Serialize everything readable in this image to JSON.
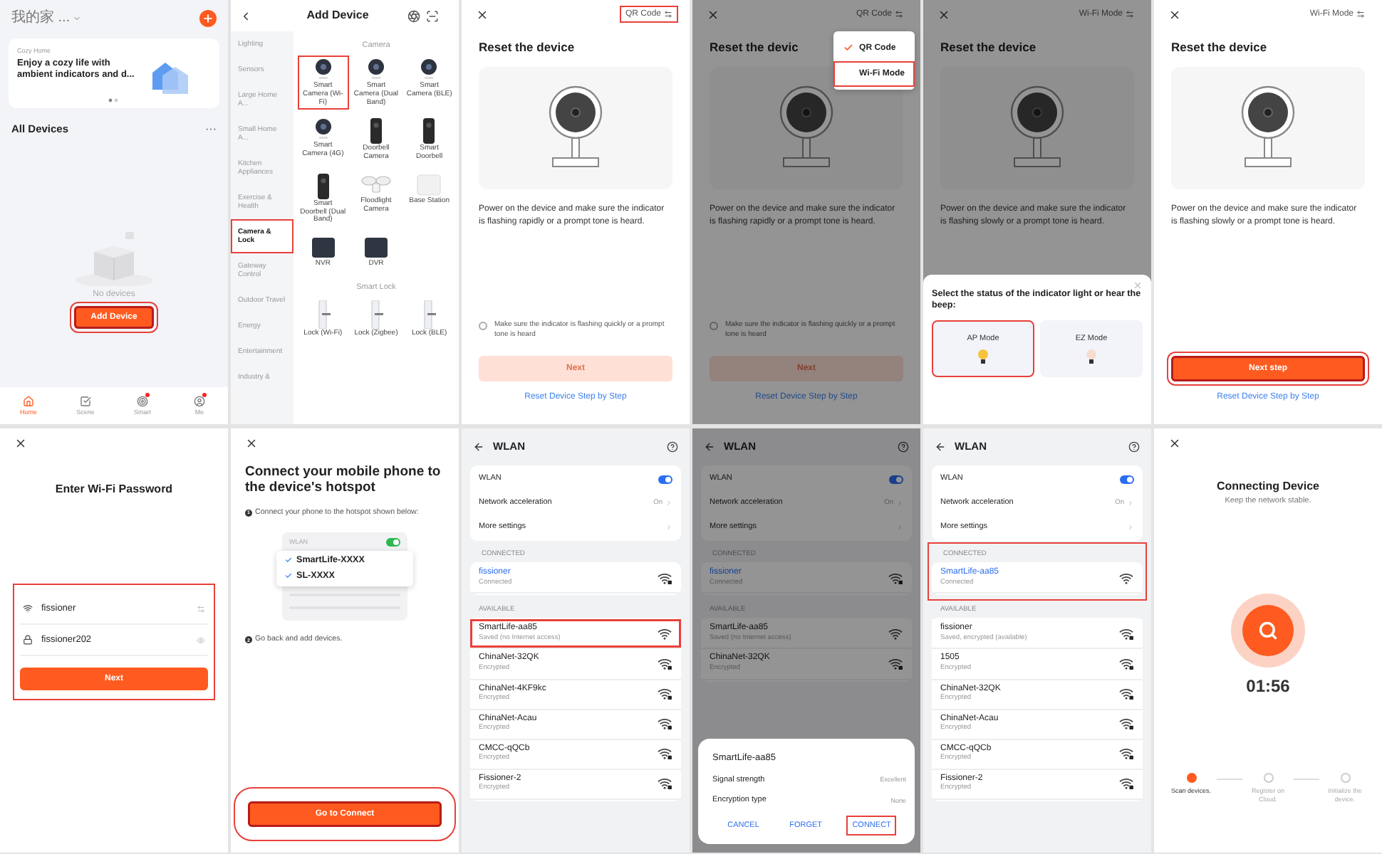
{
  "screens": [
    {
      "kind": "home",
      "home_name": "我的家 ...",
      "banner": {
        "label": "Cozy Home",
        "text": "Enjoy a cozy life with ambient indicators and d..."
      },
      "section_title": "All Devices",
      "more": "···",
      "empty_text": "No devices",
      "add_button": {
        "label": "Add Device",
        "highlighted": true
      },
      "tabs": [
        {
          "kind": "home",
          "label": "Home",
          "selected": true,
          "badge": false
        },
        {
          "kind": "scene",
          "label": "Scene",
          "selected": false,
          "badge": false
        },
        {
          "kind": "smart",
          "label": "Smart",
          "selected": false,
          "badge": true
        },
        {
          "kind": "me",
          "label": "Me",
          "selected": false,
          "badge": true
        }
      ]
    },
    {
      "kind": "catalog",
      "title": "Add Device",
      "categories": [
        {
          "label": "Lighting",
          "selected": false,
          "highlighted": false
        },
        {
          "label": "Sensors",
          "selected": false,
          "highlighted": false
        },
        {
          "label": "Large Home A...",
          "selected": false,
          "highlighted": false
        },
        {
          "label": "Small Home A...",
          "selected": false,
          "highlighted": false
        },
        {
          "label": "Kitchen Appliances",
          "selected": false,
          "highlighted": false
        },
        {
          "label": "Exercise & Health",
          "selected": false,
          "highlighted": false
        },
        {
          "label": "Camera & Lock",
          "selected": true,
          "highlighted": true
        },
        {
          "label": "Gateway Control",
          "selected": false,
          "highlighted": false
        },
        {
          "label": "Outdoor Travel",
          "selected": false,
          "highlighted": false
        },
        {
          "label": "Energy",
          "selected": false,
          "highlighted": false
        },
        {
          "label": "Entertainment",
          "selected": false,
          "highlighted": false
        },
        {
          "label": "Industry &",
          "selected": false,
          "highlighted": false
        }
      ],
      "sections": [
        {
          "title": "Camera",
          "items": [
            {
              "kind": "camera",
              "label": "Smart Camera (Wi-Fi)",
              "highlighted": true
            },
            {
              "kind": "camera",
              "label": "Smart Camera (Dual Band)",
              "highlighted": false
            },
            {
              "kind": "camera",
              "label": "Smart Camera (BLE)",
              "highlighted": false
            },
            {
              "kind": "camera",
              "label": "Smart Camera (4G)",
              "highlighted": false
            },
            {
              "kind": "doorbell",
              "label": "Doorbell Camera",
              "highlighted": false
            },
            {
              "kind": "doorbell",
              "label": "Smart Doorbell",
              "highlighted": false
            },
            {
              "kind": "doorbell",
              "label": "Smart Doorbell (Dual Band)",
              "highlighted": false
            },
            {
              "kind": "floodlight",
              "label": "Floodlight Camera",
              "highlighted": false
            },
            {
              "kind": "station",
              "label": "Base Station",
              "highlighted": false
            },
            {
              "kind": "recorder",
              "label": "NVR",
              "highlighted": false
            },
            {
              "kind": "recorder",
              "label": "DVR",
              "highlighted": false
            }
          ]
        },
        {
          "title": "Smart Lock",
          "items": [
            {
              "kind": "lock",
              "label": "Lock (Wi-Fi)",
              "highlighted": false
            },
            {
              "kind": "lock",
              "label": "Lock (Zigbee)",
              "highlighted": false
            },
            {
              "kind": "lock",
              "label": "Lock (BLE)",
              "highlighted": false
            }
          ]
        }
      ]
    },
    {
      "kind": "reset",
      "dimmed": false,
      "mode": {
        "label": "QR Code",
        "highlighted": true
      },
      "title": "Reset the device",
      "description": "Power on the device and make sure the indicator is flashing rapidly or a prompt tone is heard.",
      "confirm": {
        "label": "Make sure the indicator is flashing quickly or a prompt tone is heard",
        "checked": false
      },
      "next": {
        "label": "Next",
        "disabled": true,
        "highlighted": false
      },
      "link": "Reset Device Step by Step"
    },
    {
      "kind": "reset",
      "dimmed": true,
      "mode": {
        "label": "QR Code",
        "highlighted": false
      },
      "title": "Reset the devic",
      "description": "Power on the device and make sure the indicator is flashing rapidly or a prompt tone is heard.",
      "confirm": {
        "label": "Make sure the indicator is flashing quickly or a prompt tone is heard",
        "checked": false
      },
      "next": {
        "label": "Next",
        "disabled": true,
        "highlighted": false
      },
      "link": "Reset Device Step by Step",
      "menu": [
        {
          "label": "QR Code",
          "selected": true,
          "highlighted": false
        },
        {
          "label": "Wi-Fi Mode",
          "selected": false,
          "highlighted": true
        }
      ]
    },
    {
      "kind": "reset",
      "dimmed": true,
      "mode": {
        "label": "Wi-Fi Mode",
        "highlighted": false
      },
      "title": "Reset the device",
      "description": "Power on the device and make sure the indicator is flashing slowly or a prompt tone is heard.",
      "sheet": {
        "prompt": "Select the status of the indicator light or hear the beep:",
        "options": [
          {
            "label": "AP Mode",
            "kind": "bright",
            "highlighted": true
          },
          {
            "label": "EZ Mode",
            "kind": "faint",
            "highlighted": false
          }
        ]
      }
    },
    {
      "kind": "reset",
      "dimmed": false,
      "mode": {
        "label": "Wi-Fi Mode",
        "highlighted": false
      },
      "title": "Reset the device",
      "description": "Power on the device and make sure the indicator is flashing slowly or a prompt tone is heard.",
      "next": {
        "label": "Next step",
        "disabled": false,
        "highlighted": true
      },
      "link": "Reset Device Step by Step"
    },
    {
      "kind": "password",
      "title": "Enter Wi-Fi Password",
      "highlighted": true,
      "network": "fissioner",
      "password": "fissioner202",
      "next": {
        "label": "Next"
      }
    },
    {
      "kind": "hotspot",
      "title": "Connect your mobile phone to the device's hotspot",
      "steps": [
        {
          "number": "1",
          "text": "Connect your phone to the hotspot shown below:"
        },
        {
          "number": "2",
          "text": "Go back and add devices."
        }
      ],
      "wlan_label": "WLAN",
      "wlan_on": true,
      "hotspots": [
        {
          "name": "SmartLife-XXXX",
          "checked": true
        },
        {
          "name": "SL-XXXX",
          "checked": true
        }
      ],
      "button": {
        "label": "Go to Connect",
        "highlighted": true
      }
    },
    {
      "kind": "wlan",
      "dimmed": false,
      "title": "WLAN",
      "settings": {
        "wlan": {
          "label": "WLAN",
          "on": true
        },
        "acceleration": {
          "label": "Network acceleration",
          "value": "On"
        },
        "more": "More settings"
      },
      "connected_label": "CONNECTED",
      "connected_highlighted": false,
      "connected": {
        "name": "fissioner",
        "status": "Connected",
        "locked": true
      },
      "available_label": "AVAILABLE",
      "available": [
        {
          "name": "SmartLife-aa85",
          "status": "Saved (no Internet access)",
          "locked": false,
          "highlighted": true
        },
        {
          "name": "ChinaNet-32QK",
          "status": "Encrypted",
          "locked": true,
          "highlighted": false
        },
        {
          "name": "ChinaNet-4KF9kc",
          "status": "Encrypted",
          "locked": true,
          "highlighted": false
        },
        {
          "name": "ChinaNet-Acau",
          "status": "Encrypted",
          "locked": true,
          "highlighted": false
        },
        {
          "name": "CMCC-qQCb",
          "status": "Encrypted",
          "locked": true,
          "highlighted": false
        },
        {
          "name": "Fissioner-2",
          "status": "Encrypted",
          "locked": true,
          "highlighted": false
        }
      ]
    },
    {
      "kind": "wlan",
      "dimmed": true,
      "title": "WLAN",
      "settings": {
        "wlan": {
          "label": "WLAN",
          "on": true
        },
        "acceleration": {
          "label": "Network acceleration",
          "value": "On"
        },
        "more": "More settings"
      },
      "connected_label": "CONNECTED",
      "connected_highlighted": false,
      "connected": {
        "name": "fissioner",
        "status": "Connected",
        "locked": true
      },
      "available_label": "AVAILABLE",
      "available": [
        {
          "name": "SmartLife-aa85",
          "status": "Saved (no Internet access)",
          "locked": false,
          "highlighted": false
        },
        {
          "name": "ChinaNet-32QK",
          "status": "Encrypted",
          "locked": true,
          "highlighted": false
        }
      ],
      "dialog": {
        "title": "SmartLife-aa85",
        "rows": [
          {
            "label": "Signal strength",
            "value": "Excellent"
          },
          {
            "label": "Encryption type",
            "value": "None"
          }
        ],
        "actions": [
          {
            "label": "CANCEL",
            "highlighted": false
          },
          {
            "label": "FORGET",
            "highlighted": false
          },
          {
            "label": "CONNECT",
            "highlighted": true
          }
        ]
      }
    },
    {
      "kind": "wlan",
      "dimmed": false,
      "title": "WLAN",
      "settings": {
        "wlan": {
          "label": "WLAN",
          "on": true
        },
        "acceleration": {
          "label": "Network acceleration",
          "value": "On"
        },
        "more": "More settings"
      },
      "connected_label": "CONNECTED",
      "connected_highlighted": true,
      "connected": {
        "name": "SmartLife-aa85",
        "status": "Connected",
        "locked": false
      },
      "available_label": "AVAILABLE",
      "available": [
        {
          "name": "fissioner",
          "status": "Saved, encrypted (available)",
          "locked": true,
          "highlighted": false
        },
        {
          "name": "1505",
          "status": "Encrypted",
          "locked": true,
          "highlighted": false
        },
        {
          "name": "ChinaNet-32QK",
          "status": "Encrypted",
          "locked": true,
          "highlighted": false
        },
        {
          "name": "ChinaNet-Acau",
          "status": "Encrypted",
          "locked": true,
          "highlighted": false
        },
        {
          "name": "CMCC-qQCb",
          "status": "Encrypted",
          "locked": true,
          "highlighted": false
        },
        {
          "name": "Fissioner-2",
          "status": "Encrypted",
          "locked": true,
          "highlighted": false
        }
      ]
    },
    {
      "kind": "connecting",
      "title": "Connecting Device",
      "subtitle": "Keep the network stable.",
      "timer": "01:56",
      "steps": [
        {
          "label": "Scan devices.",
          "done": true
        },
        {
          "label": "Register on Cloud.",
          "done": false
        },
        {
          "label": "Initialize the device.",
          "done": false
        }
      ]
    }
  ]
}
